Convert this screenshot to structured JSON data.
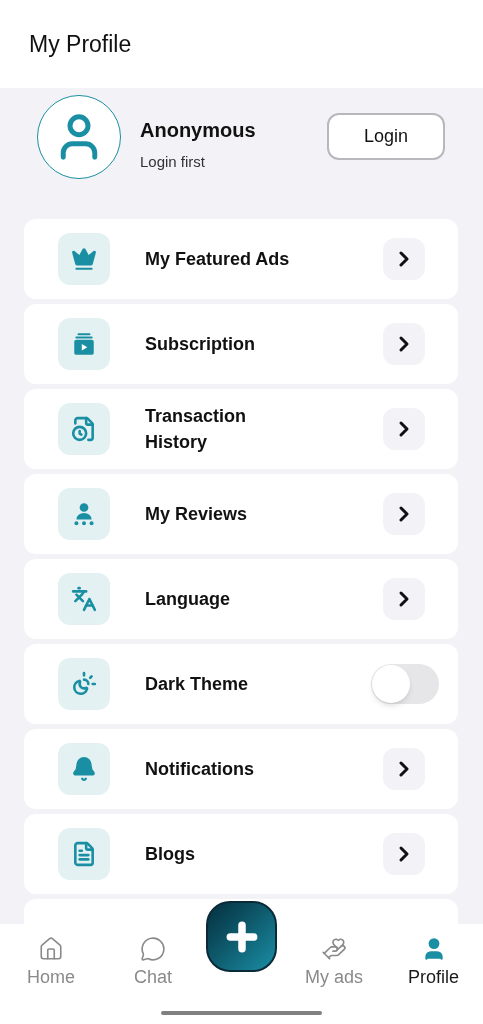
{
  "header": {
    "title": "My Profile"
  },
  "profile": {
    "name": "Anonymous",
    "subtitle": "Login first",
    "login_button": "Login"
  },
  "menu": [
    {
      "label": "My Featured Ads",
      "kind": "chevron"
    },
    {
      "label": "Subscription",
      "kind": "chevron"
    },
    {
      "label": "Transaction History",
      "kind": "chevron"
    },
    {
      "label": "My Reviews",
      "kind": "chevron"
    },
    {
      "label": "Language",
      "kind": "chevron"
    },
    {
      "label": "Dark Theme",
      "kind": "toggle",
      "on": false
    },
    {
      "label": "Notifications",
      "kind": "chevron"
    },
    {
      "label": "Blogs",
      "kind": "chevron"
    }
  ],
  "bottom_nav": [
    {
      "label": "Home",
      "selected": false
    },
    {
      "label": "Chat",
      "selected": false
    },
    {
      "label": "My ads",
      "selected": false
    },
    {
      "label": "Profile",
      "selected": true
    }
  ]
}
